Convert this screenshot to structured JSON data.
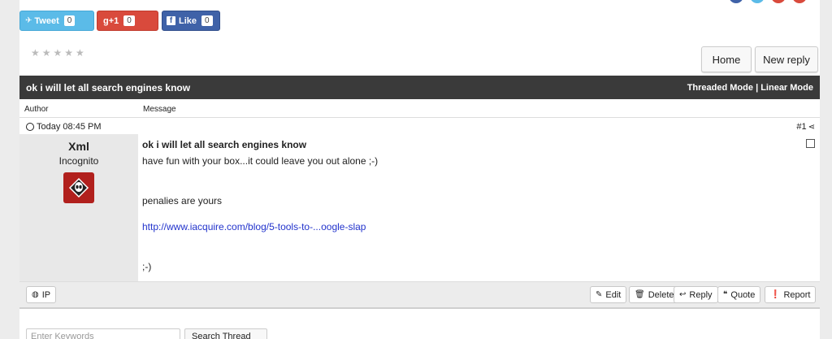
{
  "share": {
    "tweet_label": "Tweet",
    "tweet_count": "0",
    "gplus_label": "g+1",
    "gplus_count": "0",
    "like_label": "Like",
    "like_count": "0"
  },
  "rating": {
    "stars": "★★★★★"
  },
  "nav": {
    "home_label": "Home",
    "new_reply_label": "New reply"
  },
  "thread": {
    "title": "ok i will let all search engines know",
    "threaded_mode": "Threaded Mode",
    "mode_separator": "|",
    "linear_mode": "Linear Mode"
  },
  "columns": {
    "author": "Author",
    "message": "Message"
  },
  "post": {
    "date": "Today 08:45 PM",
    "number": "#1",
    "author_name": "Xml",
    "author_title": "Incognito",
    "subject": "ok i will let all search engines know",
    "line1": "have fun with your box...it could leave you out alone ;-)",
    "line2": "penalies are yours",
    "link": "http://www.iacquire.com/blog/5-tools-to-...oogle-slap",
    "line3": ";-)"
  },
  "actions": {
    "ip": "IP",
    "edit": "Edit",
    "delete": "Delete",
    "reply": "Reply",
    "quote": "Quote",
    "report": "Report"
  },
  "search": {
    "placeholder": "Enter Keywords",
    "button": "Search Thread"
  },
  "colors": {
    "dark_bar": "#3a3a3a",
    "twitter": "#5bbbe8",
    "gplus": "#d94a3c",
    "facebook": "#3f62a8",
    "link": "#2233cc"
  }
}
